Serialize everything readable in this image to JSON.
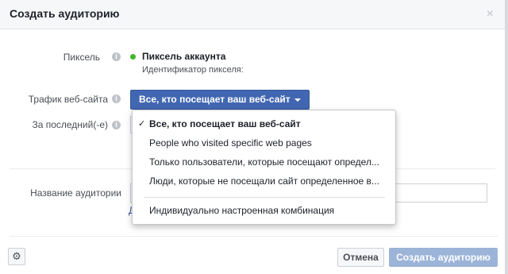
{
  "dialog": {
    "title": "Создать аудиторию",
    "close_glyph": "×"
  },
  "pixel": {
    "label": "Пиксель",
    "name": "Пиксель аккаунта",
    "id_caption": "Идентификатор пикселя:",
    "status_color": "#42b72a"
  },
  "traffic": {
    "label": "Трафик веб-сайта",
    "selected": "Все, кто посещает ваш веб-сайт"
  },
  "period": {
    "label": "За последний(-е)"
  },
  "audience_name": {
    "label": "Название аудитории",
    "value": "",
    "hint_glyph": "Д"
  },
  "dropdown": {
    "check_glyph": "✓",
    "items": [
      {
        "label": "Все, кто посещает ваш веб-сайт",
        "selected": true
      },
      {
        "label": "People who visited specific web pages",
        "selected": false
      },
      {
        "label": "Только пользователи, которые посещают определ...",
        "selected": false
      },
      {
        "label": "Люди, которые не посещали сайт определенное в...",
        "selected": false
      },
      {
        "label": "Индивидуально настроенная комбинация",
        "selected": false
      }
    ]
  },
  "footer": {
    "cancel_label": "Отмена",
    "create_label": "Создать аудиторию",
    "settings_glyph": "⚙"
  },
  "colors": {
    "primary": "#4267b2",
    "disabled_primary": "#9cb4d8",
    "link": "#365899"
  }
}
